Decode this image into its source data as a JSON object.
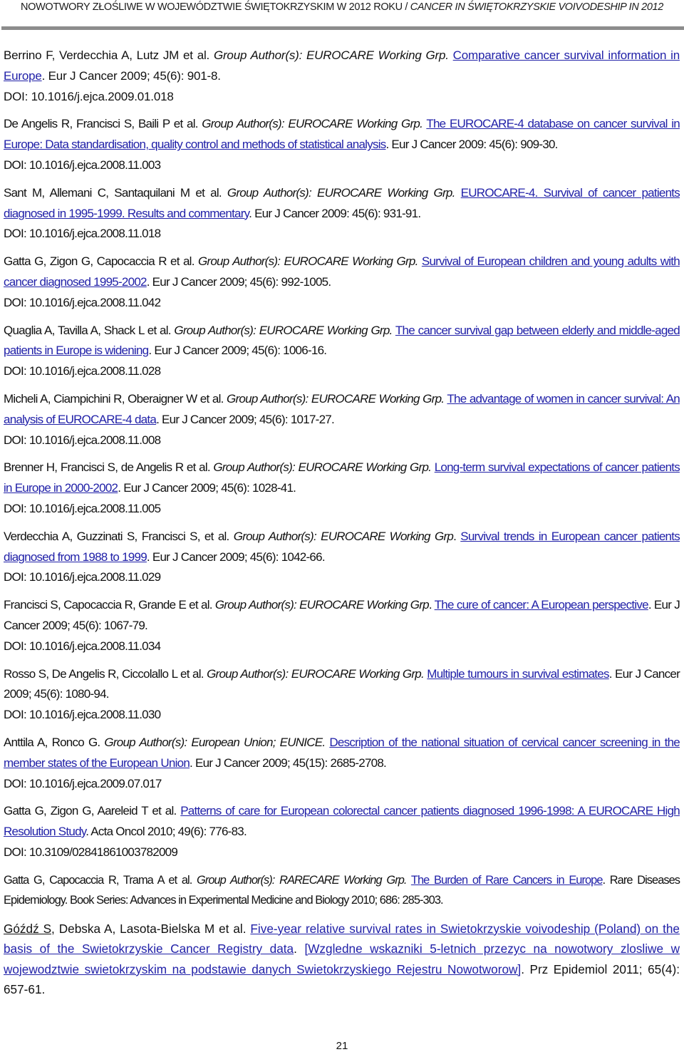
{
  "header": {
    "title_pl": "NOWOTWORY ZŁOŚLIWE W WOJEWÓDZTWIE ŚWIĘTOKRZYSKIM W 2012 ROKU / ",
    "title_en": "CANCER IN ŚWIĘTOKRZYSKIE VOIVODESHIP IN 2012"
  },
  "references": [
    {
      "authors": "Berrino F, Verdecchia A, Lutz JM et al. ",
      "group": "Group Author(s): EUROCARE Working Grp.",
      "title": "Comparative cancer survival information in Europe",
      "source": ". Eur J Cancer  2009; 45(6): 901-8.",
      "doi": "DOI: 10.1016/j.ejca.2009.01.018"
    },
    {
      "authors": "De Angelis R, Francisci S, Baili P et al. ",
      "group": "Group Author(s): EUROCARE Working Grp.",
      "title": "The EUROCARE-4 database on cancer survival in Europe: Data standardisation, quality control and methods of statistical analysis",
      "source": ". Eur J Cancer 2009: 45(6): 909-30.",
      "doi": "DOI: 10.1016/j.ejca.2008.11.003"
    },
    {
      "authors": "Sant M, Allemani C, Santaquilani M et al. ",
      "group": "Group Author(s): EUROCARE Working Grp.",
      "title": "EUROCARE-4. Survival of cancer patients diagnosed in 1995-1999. Results and commentary",
      "source": ". Eur J Cancer 2009: 45(6): 931-91.",
      "doi": "DOI: 10.1016/j.ejca.2008.11.018"
    },
    {
      "authors": "Gatta G, Zigon G, Capocaccia R et al. ",
      "group": "Group Author(s): EUROCARE Working Grp.",
      "title": "Survival of European children and young adults with cancer diagnosed 1995-2002",
      "source": ". Eur J Cancer 2009; 45(6): 992-1005.",
      "doi": "DOI: 10.1016/j.ejca.2008.11.042"
    },
    {
      "authors": "Quaglia A, Tavilla A, Shack L et al. ",
      "group": "Group Author(s): EUROCARE Working Grp.",
      "title": "The cancer survival gap between elderly and middle-aged patients in Europe is widening",
      "source": ". Eur J Cancer 2009; 45(6): 1006-16.",
      "doi": "DOI: 10.1016/j.ejca.2008.11.028"
    },
    {
      "authors": "Micheli A, Ciampichini R, Oberaigner W et al. ",
      "group": "Group Author(s): EUROCARE Working Grp.",
      "title": "The advantage of women in cancer survival: An analysis of EUROCARE-4 data",
      "source": ". Eur J Cancer 2009; 45(6): 1017-27.",
      "doi": "DOI: 10.1016/j.ejca.2008.11.008"
    },
    {
      "authors": "Brenner H, Francisci S, de Angelis R et al. ",
      "group": "Group Author(s): EUROCARE Working Grp.",
      "title": "Long-term survival expectations of cancer patients in Europe in 2000-2002",
      "source": ". Eur J Cancer 2009; 45(6): 1028-41.",
      "doi": "DOI: 10.1016/j.ejca.2008.11.005"
    },
    {
      "authors": "Verdecchia A, Guzzinati S, Francisci S, et al. ",
      "group": "Group Author(s): EUROCARE Working Grp",
      "title": "Survival trends in European cancer patients diagnosed from 1988 to 1999",
      "source": ". Eur J Cancer 2009; 45(6): 1042-66.",
      "doi": "DOI: 10.1016/j.ejca.2008.11.029",
      "group_suffix": ". "
    },
    {
      "authors": "Francisci S, Capocaccia R, Grande E et al. ",
      "group": "Group Author(s): EUROCARE Working Grp",
      "title": "The cure of cancer: A European perspective",
      "source": ". Eur J Cancer 2009; 45(6): 1067-79.",
      "doi": "DOI: 10.1016/j.ejca.2008.11.034",
      "group_suffix": ". "
    },
    {
      "authors": "Rosso S, De Angelis R, Ciccolallo L et al. ",
      "group": "Group Author(s): EUROCARE Working Grp.",
      "title": "Multiple tumours in survival estimates",
      "source": ". Eur J Cancer 2009; 45(6): 1080-94.",
      "doi": "DOI: 10.1016/j.ejca.2008.11.030"
    },
    {
      "authors": "Anttila A, Ronco G. ",
      "group": "Group Author(s): European Union; EUNICE.",
      "title": "Description of the national situation of cervical cancer screening in the member states of the European Union",
      "source": ". Eur J Cancer 2009; 45(15): 2685-2708.",
      "doi": "DOI: 10.1016/j.ejca.2009.07.017"
    },
    {
      "authors": "Gatta G, Zigon G, Aareleid T et al. ",
      "group": "",
      "title": "Patterns of care for European colorectal cancer patients diagnosed 1996-1998: A EUROCARE High Resolution Study",
      "source": ". Acta Oncol 2010; 49(6): 776-83.",
      "doi": "DOI: 10.3109/02841861003782009"
    },
    {
      "authors": "Gatta G, Capocaccia R, Trama A et al. ",
      "group": "Group Author(s): RARECARE Working Grp.",
      "title": "The Burden of Rare Cancers in Europe",
      "source": ". Rare Diseases Epidemiology. Book Series: Advances in Experimental Medicine and Biology 2010; 686: 285-303.",
      "doi": ""
    },
    {
      "authors_underlined": "Góźdź S,",
      "authors": " Debska A, Lasota-Bielska M et al. ",
      "group": "",
      "title": "Five-year relative survival rates in Swietokrzyskie voivodeship (Poland) on the basis of the Swietokrzyskie Cancer Registry data",
      "mid": ". ",
      "title2": "[Wzgledne wskazniki 5-letnich przezyc na nowotwory zlosliwe w wojewodztwie swietokrzyskim na podstawie danych Swietokrzyskiego Rejestru Nowotworow]",
      "source": ". Prz Epidemiol 2011; 65(4): 657-61.",
      "doi": ""
    }
  ],
  "footer": {
    "page_number": "21"
  },
  "colors": {
    "link": "#2121a8",
    "rule": "#8c8c8c"
  }
}
